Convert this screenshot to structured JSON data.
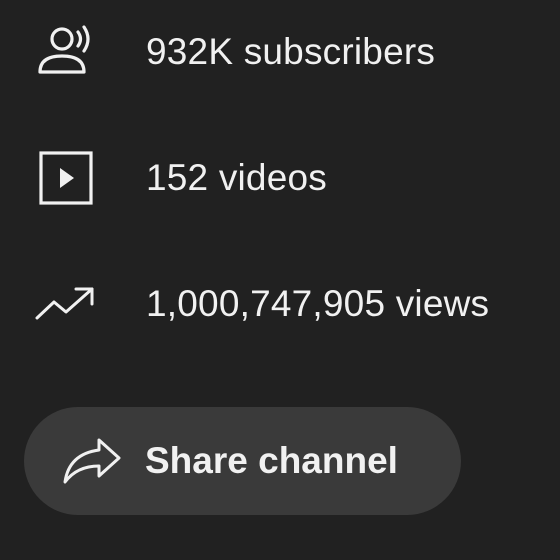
{
  "stats": {
    "subscribers": {
      "icon": "subscribers-icon",
      "text": "932K subscribers"
    },
    "videos": {
      "icon": "video-play-icon",
      "text": "152 videos"
    },
    "views": {
      "icon": "trending-icon",
      "text": "1,000,747,905 views"
    }
  },
  "share_button": {
    "icon": "share-arrow-icon",
    "label": "Share channel"
  },
  "colors": {
    "background": "#212121",
    "text": "#f1f1f1",
    "button_bg": "#3a3a3a"
  }
}
